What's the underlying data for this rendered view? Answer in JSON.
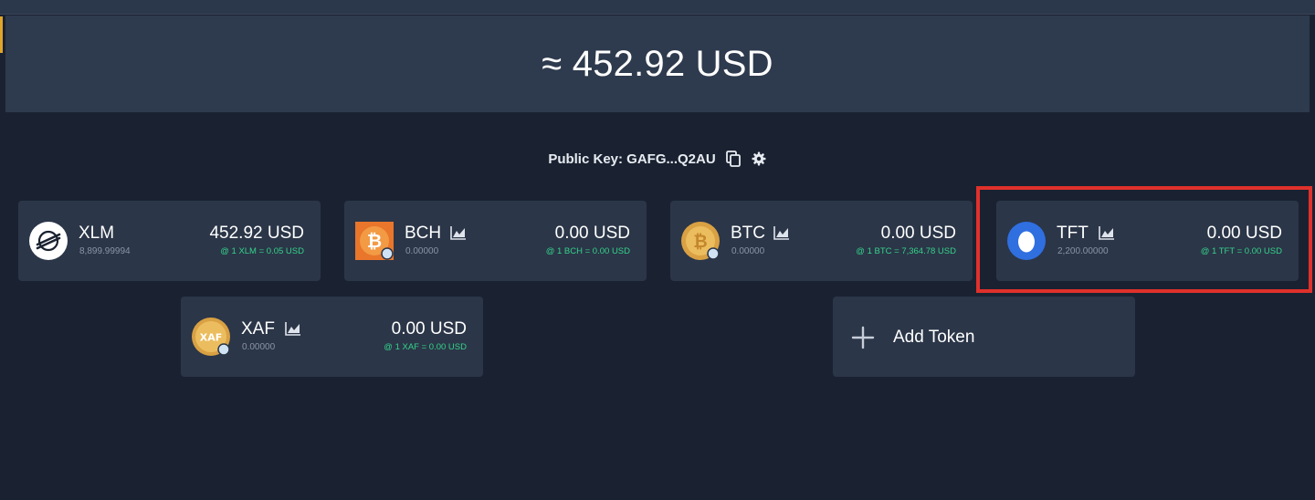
{
  "balance": {
    "total": "≈ 452.92 USD"
  },
  "account": {
    "public_key": "Public Key: GAFG...Q2AU"
  },
  "tokens": [
    {
      "symbol": "XLM",
      "amount": "8,899.99994",
      "usd": "452.92 USD",
      "rate": "@ 1 XLM = 0.05 USD",
      "icon": "stellar-logo-icon",
      "color": "#ffffff"
    },
    {
      "symbol": "BCH",
      "amount": "0.00000",
      "usd": "0.00 USD",
      "rate": "@ 1 BCH = 0.00 USD",
      "icon": "bitcoin-cash-icon",
      "color": "#f0913a"
    },
    {
      "symbol": "BTC",
      "amount": "0.00000",
      "usd": "0.00 USD",
      "rate": "@ 1 BTC = 7,364.78 USD",
      "icon": "bitcoin-icon",
      "color": "#e8b04c"
    },
    {
      "symbol": "TFT",
      "amount": "2,200.00000",
      "usd": "0.00 USD",
      "rate": "@ 1 TFT = 0.00 USD",
      "icon": "tft-egg-icon",
      "color": "#2f6fe0"
    },
    {
      "symbol": "XAF",
      "amount": "0.00000",
      "usd": "0.00 USD",
      "rate": "@ 1 XAF = 0.00 USD",
      "icon": "xaf-coin-icon",
      "color": "#e8b04c"
    }
  ],
  "add_token": {
    "label": "Add Token"
  },
  "colors": {
    "accent": "#e0a52a",
    "positive": "#34d38a",
    "highlight": "#e0312b"
  }
}
